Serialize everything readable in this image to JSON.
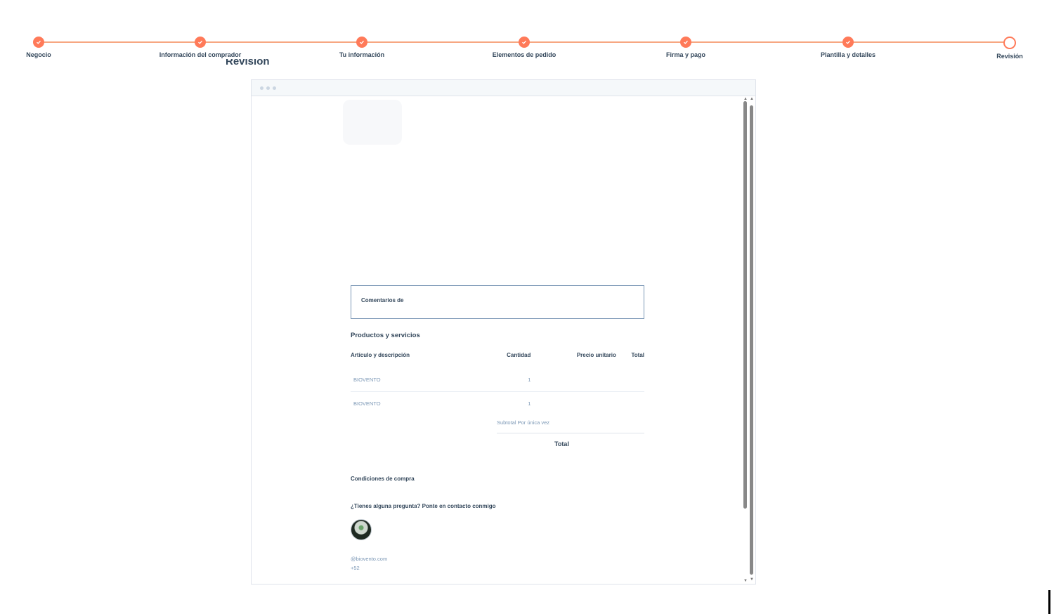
{
  "stepper": {
    "steps": [
      {
        "label": "Negocio",
        "done": true
      },
      {
        "label": "Información del comprador",
        "done": true
      },
      {
        "label": "Tu información",
        "done": true
      },
      {
        "label": "Elementos de pedido",
        "done": true
      },
      {
        "label": "Firma y pago",
        "done": true
      },
      {
        "label": "Plantilla y detalles",
        "done": true
      },
      {
        "label": "Revisión",
        "done": false
      }
    ],
    "accent_color": "#ff7a59"
  },
  "page": {
    "heading": "Revisión"
  },
  "preview": {
    "comments_label": "Comentarios de",
    "products_title": "Productos y servicios",
    "columns": {
      "item": "Artículo y descripción",
      "qty": "Cantidad",
      "unit_price": "Precio unitario",
      "total": "Total"
    },
    "rows": [
      {
        "item": "BIOVENTO",
        "qty": "1",
        "unit_price": "",
        "total": ""
      },
      {
        "item": "BIOVENTO",
        "qty": "1",
        "unit_price": "",
        "total": ""
      }
    ],
    "subtotal_label": "Subtotal Por única vez",
    "total_label": "Total",
    "conditions_title": "Condiciones de compra",
    "contact_title": "¿Tienes alguna pregunta? Ponte en contacto conmigo",
    "email": "@biovento.com",
    "phone": "+52"
  }
}
